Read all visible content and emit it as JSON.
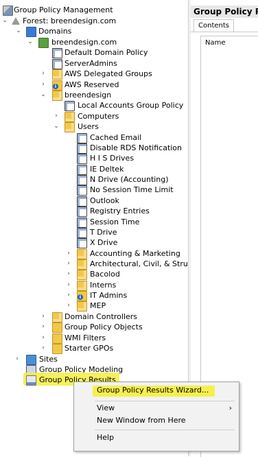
{
  "tree": {
    "root": "Group Policy Management",
    "forest": "Forest: breendesign.com",
    "domains": "Domains",
    "domain": "breendesign.com",
    "default_domain_policy": "Default Domain Policy",
    "server_admins": "ServerAdmins",
    "aws_delegated_groups": "AWS Delegated Groups",
    "aws_reserved": "AWS Reserved",
    "breendesign": "breendesign",
    "local_accounts_gp": "Local Accounts Group Policy",
    "computers": "Computers",
    "users": "Users",
    "user_gpos": [
      "Cached Email",
      "Disable RDS Notification",
      "H I S Drives",
      "IE Deltek",
      "N Drive (Accounting)",
      "No Session Time Limit",
      "Outlook",
      "Registry Entries",
      "Session Time",
      "T Drive",
      "X Drive"
    ],
    "user_ous": [
      "Accounting & Marketing",
      "Architectural, Civil, & Struc",
      "Bacolod",
      "Interns",
      "IT Admins",
      "MEP"
    ],
    "domain_controllers": "Domain Controllers",
    "group_policy_objects": "Group Policy Objects",
    "wmi_filters": "WMI Filters",
    "starter_gpos": "Starter GPOs",
    "sites": "Sites",
    "gp_modeling": "Group Policy Modeling",
    "gp_results": "Group Policy Results"
  },
  "right_pane": {
    "title": "Group Policy R",
    "tab": "Contents",
    "column": "Name"
  },
  "context_menu": {
    "wizard": "Group Policy Results Wizard...",
    "view": "View",
    "new_window": "New Window from Here",
    "help": "Help"
  }
}
